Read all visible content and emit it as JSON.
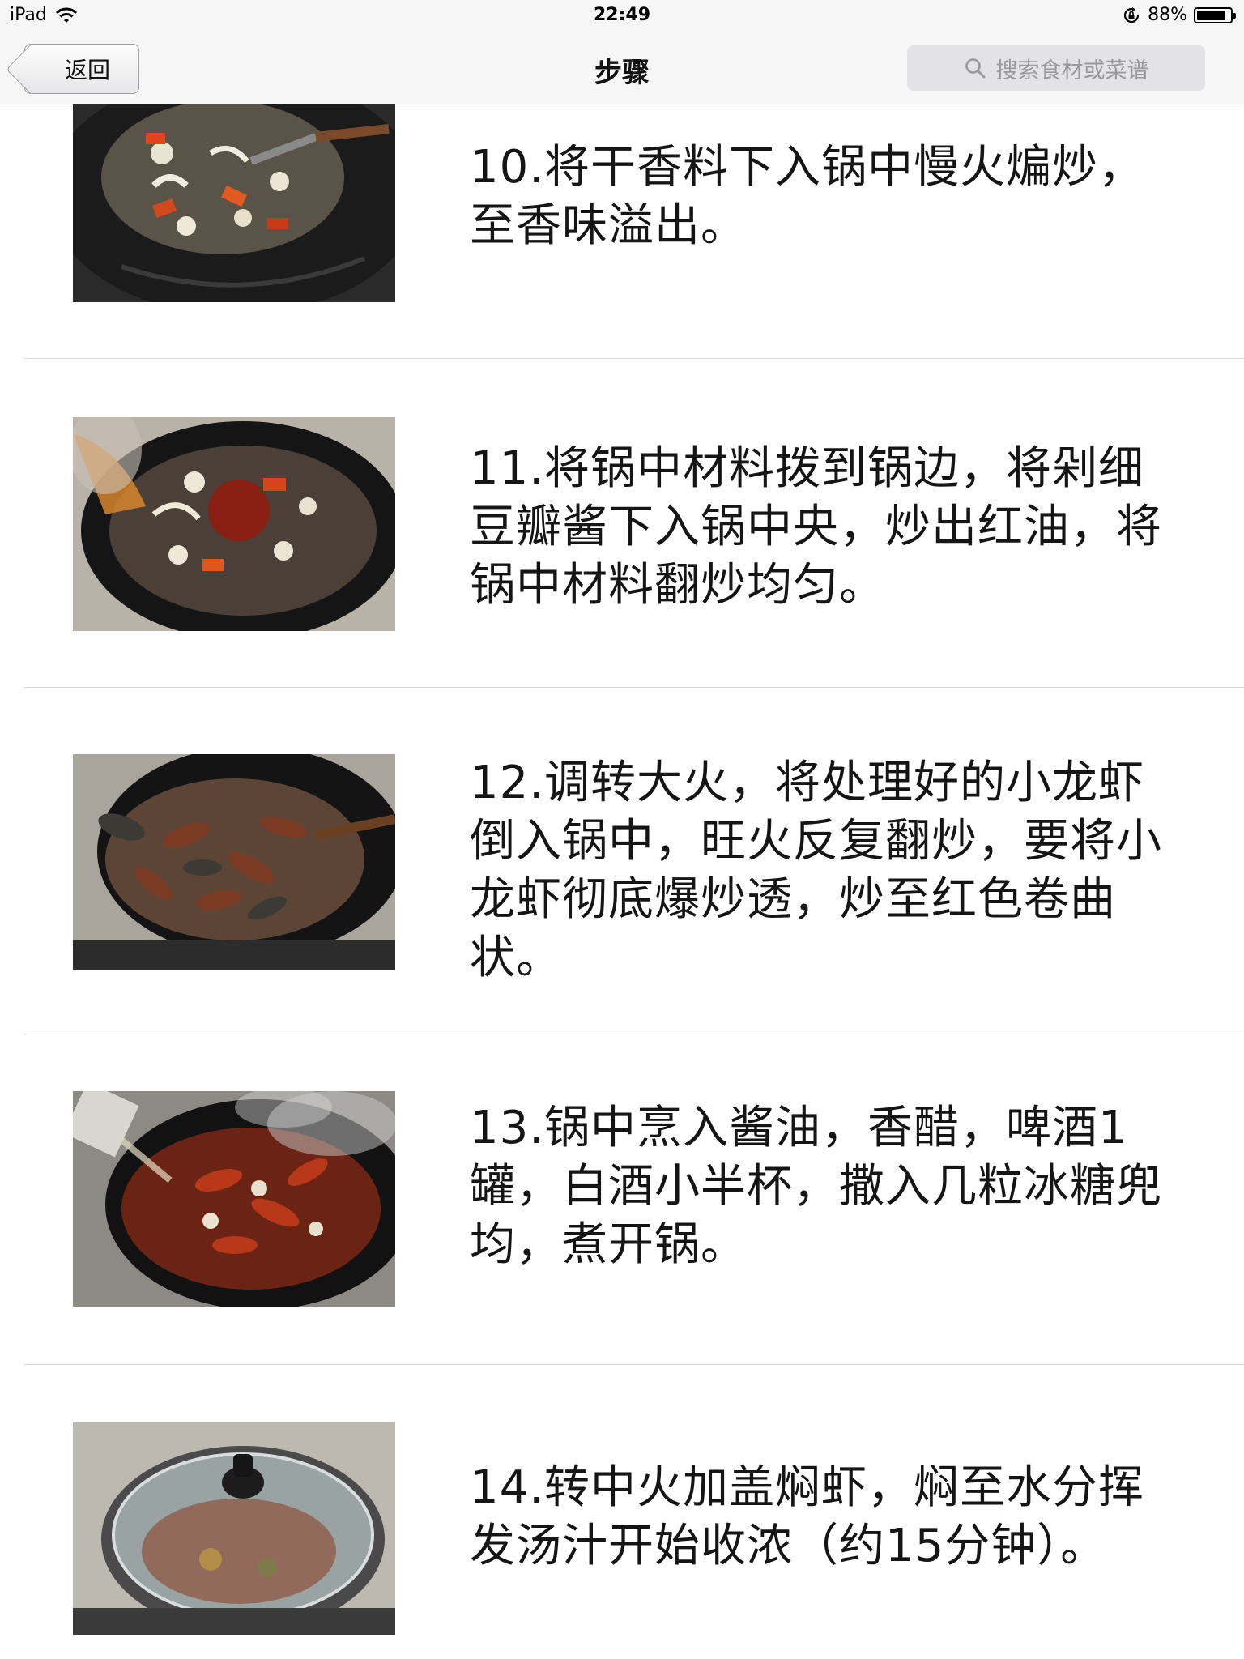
{
  "status_bar": {
    "device": "iPad",
    "time": "22:49",
    "battery": "88%",
    "battery_level": 0.88
  },
  "nav": {
    "back_label": "返回",
    "title": "步骤",
    "search_placeholder": "搜索食材或菜谱"
  },
  "steps": [
    {
      "text": "10.将干香料下入锅中慢火煸炒，至香味溢出。",
      "photo": "dried-spices-in-wok"
    },
    {
      "text": "11.将锅中材料拨到锅边，将剁细豆瓣酱下入锅中央，炒出红油，将锅中材料翻炒均匀。",
      "photo": "bean-paste-in-wok"
    },
    {
      "text": "12.调转大火，将处理好的小龙虾倒入锅中，旺火反复翻炒，要将小龙虾彻底爆炒透，炒至红色卷曲状。",
      "photo": "crayfish-stir-fry"
    },
    {
      "text": "13.锅中烹入酱油，香醋，啤酒1罐，白酒小半杯，撒入几粒冰糖兜均，煮开锅。",
      "photo": "pouring-beer-into-wok"
    },
    {
      "text": "14.转中火加盖焖虾，焖至水分挥发汤汁开始收浓（约15分钟）。",
      "photo": "covered-wok"
    }
  ],
  "colors": {
    "bar_background": "#f6f6f7",
    "divider": "#d8d8da",
    "search_text": "#9a9a9e"
  },
  "icons": [
    "wifi-icon",
    "rotation-lock-icon",
    "battery-icon",
    "back-chevron",
    "search-icon"
  ]
}
